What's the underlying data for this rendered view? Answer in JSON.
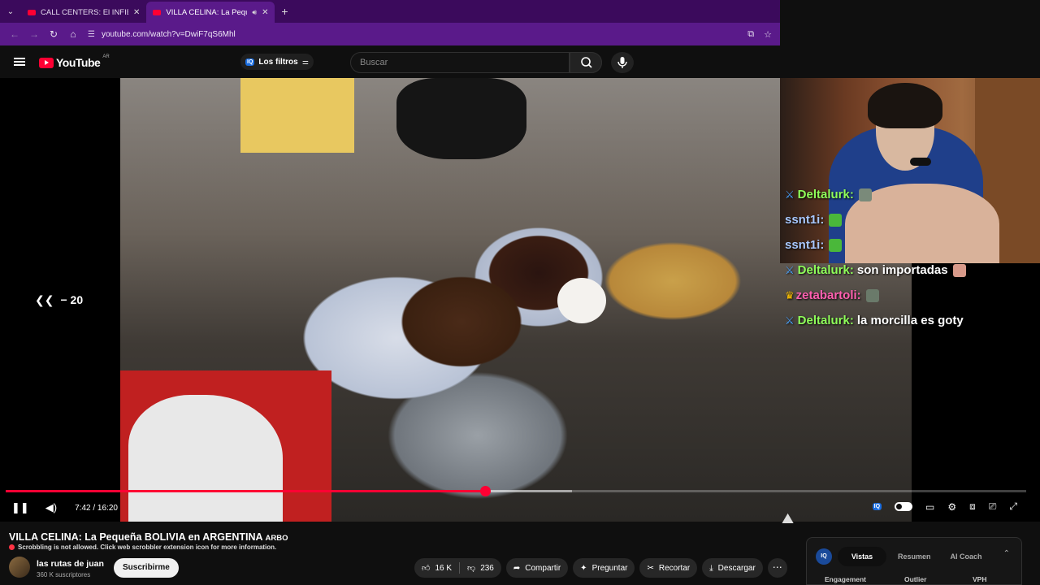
{
  "browser": {
    "tabs": [
      {
        "title": "CALL CENTERS: El INFIERNO a",
        "active": false
      },
      {
        "title": "VILLA CELINA: La Pequeña",
        "active": true
      }
    ],
    "url": "youtube.com/watch?v=DwiF7qS6Mhl"
  },
  "youtube": {
    "logo_text": "YouTube",
    "country_code": "AR",
    "filters_label": "Los filtros",
    "search_placeholder": "Buscar"
  },
  "video": {
    "seek_label": "« − 20",
    "seek_amount": "− 20",
    "current_time": "7:42",
    "duration": "16:20",
    "time_display": "7:42 / 16:20",
    "progress_played_fraction": 0.47,
    "progress_buffered_fraction": 0.555,
    "chat": [
      {
        "user": "Deltalurk",
        "message": "",
        "badge": "sword",
        "user_color": "green"
      },
      {
        "user": "ssnt1i",
        "message": "",
        "badge": "",
        "user_color": "blue"
      },
      {
        "user": "ssnt1i",
        "message": "",
        "badge": "",
        "user_color": "blue"
      },
      {
        "user": "Deltalurk",
        "message": "son importadas",
        "badge": "sword",
        "user_color": "green"
      },
      {
        "user": "zetabartoli",
        "message": "",
        "badge": "crown",
        "user_color": "pink"
      },
      {
        "user": "Deltalurk",
        "message": "la morcilla es goty",
        "badge": "sword",
        "user_color": "green"
      }
    ]
  },
  "info": {
    "title": "VILLA CELINA: La Pequeña BOLIVIA en ARGENTINA",
    "title_tag": "ARBO",
    "scrobble_notice": "Scrobbling is not allowed. Click web scrobbler extension icon for more information.",
    "channel_name": "las rutas de juan",
    "subscribers": "360 K suscriptores",
    "subscribe_label": "Suscribirme",
    "likes": "16 K",
    "dislikes": "236",
    "share_label": "Compartir",
    "ask_label": "Preguntar",
    "clip_label": "Recortar",
    "download_label": "Descargar"
  },
  "panel": {
    "badge": "IQ",
    "tabs": [
      "Vistas",
      "Resumen",
      "AI Coach"
    ],
    "active_tab": "Vistas",
    "columns": [
      "Engagement",
      "Outlier",
      "VPH"
    ]
  },
  "colors": {
    "tabbar": "#3b0a5c",
    "addressbar": "#5a1a8a",
    "accent_red": "#ff0033",
    "background": "#0f0f0f"
  }
}
